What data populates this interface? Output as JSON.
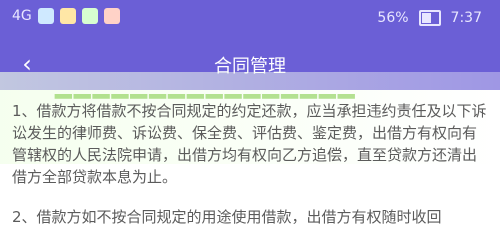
{
  "status_bar": {
    "signal": "4G",
    "battery_percent": "56%",
    "time": "7:37",
    "icons": [
      "app-icon-1",
      "app-icon-2",
      "app-icon-3",
      "app-icon-4"
    ]
  },
  "app_bar": {
    "back_icon": "chevron-left-icon",
    "title": "合同管理"
  },
  "content": {
    "para_1": "1、借款方将借款不按合同规定的约定还款，应当承担违约责任及以下诉讼发生的律师费、诉讼费、保全费、评估费、鉴定费，出借方有权向有管辖权的人民法院申请，出借方均有权向乙方追偿，直至贷款方还清出借方全部贷款本息为止。",
    "para_2": "2、借款方如不按合同规定的用途使用借款，出借方有权随时收回"
  },
  "colors": {
    "primary": "#6b5fd6",
    "text": "#5b5b5b",
    "watermark": "#78c83c"
  }
}
